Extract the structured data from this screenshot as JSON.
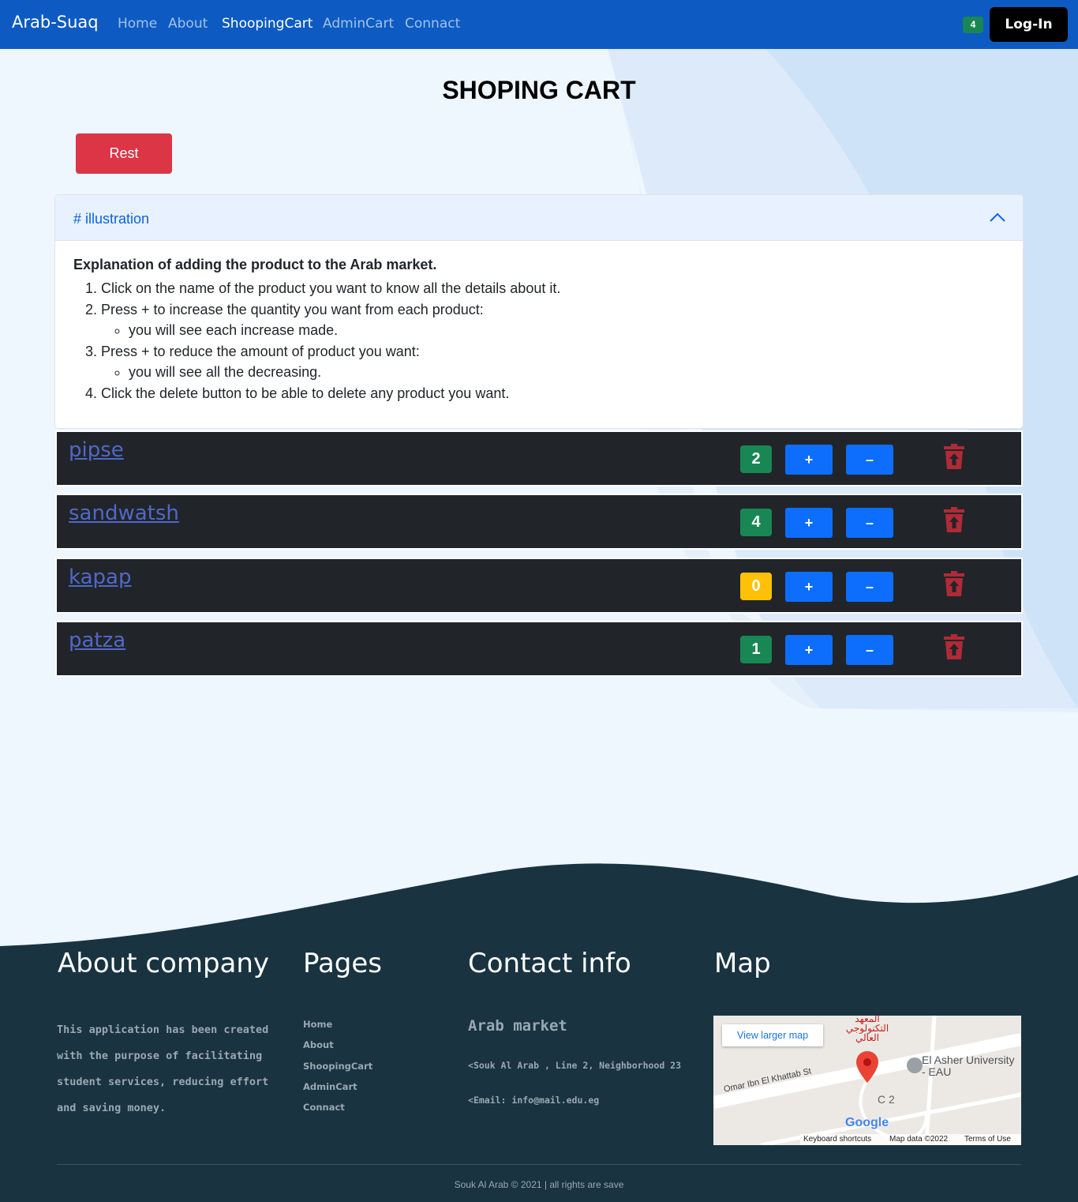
{
  "nav": {
    "brand": "Arab-Suaq",
    "links": [
      "Home",
      "About",
      "ShoopingCart",
      "AdminCart",
      "Connact"
    ],
    "active": "ShoopingCart",
    "cart_count": "4",
    "login_label": "Log-In"
  },
  "main": {
    "title": "SHOPING CART",
    "reset_label": "Rest",
    "accordion": {
      "header": "# illustration",
      "heading": "Explanation of adding the product to the Arab market.",
      "step1": "Click on the name of the product you want to know all the details about it.",
      "step2": "Press + to increase the quantity you want from each product:",
      "step2_sub": "you will see each increase made.",
      "step3": "Press + to reduce the amount of product you want:",
      "step3_sub": "you will see all the decreasing.",
      "step4": "Click the delete button to be able to delete any product you want."
    },
    "products": [
      {
        "name": "pipse",
        "qty": "2",
        "qty_color": "#198754"
      },
      {
        "name": "sandwatsh",
        "qty": "4",
        "qty_color": "#198754"
      },
      {
        "name": "kapap",
        "qty": "0",
        "qty_color": "#ffc107"
      },
      {
        "name": "patza",
        "qty": "1",
        "qty_color": "#198754"
      }
    ],
    "plus_label": "+",
    "minus_label": "–"
  },
  "footer": {
    "about_title": "About company",
    "about_text": "This application has been created with the purpose of facilitating student services, reducing effort and saving money.",
    "pages_title": "Pages",
    "pages": [
      "Home",
      "About",
      "ShoopingCart",
      "AdminCart",
      "Connact"
    ],
    "contact_title": "Contact info",
    "contact_name": "Arab market",
    "contact_address": "Souk Al Arab , Line 2, Neighborhood 23",
    "contact_email": "Email: info@mail.edu.eg",
    "map_title": "Map",
    "map": {
      "view_larger": "View larger map",
      "place1": "El Asher University - EAU",
      "street": "Omar Ibn El Khattab St",
      "place2_ar": "المعهد التكنولوجي العالي",
      "place3": "C 2",
      "keyboard": "Keyboard shortcuts",
      "map_data": "Map data ©2022",
      "terms": "Terms of Use",
      "google": "Google"
    },
    "copyright": "Souk Al Arab © 2021 | all rights are save"
  },
  "colors": {
    "navbar": "#0d5bc2",
    "footer": "#193340",
    "danger": "#dc3545",
    "primary": "#0d6efd"
  }
}
